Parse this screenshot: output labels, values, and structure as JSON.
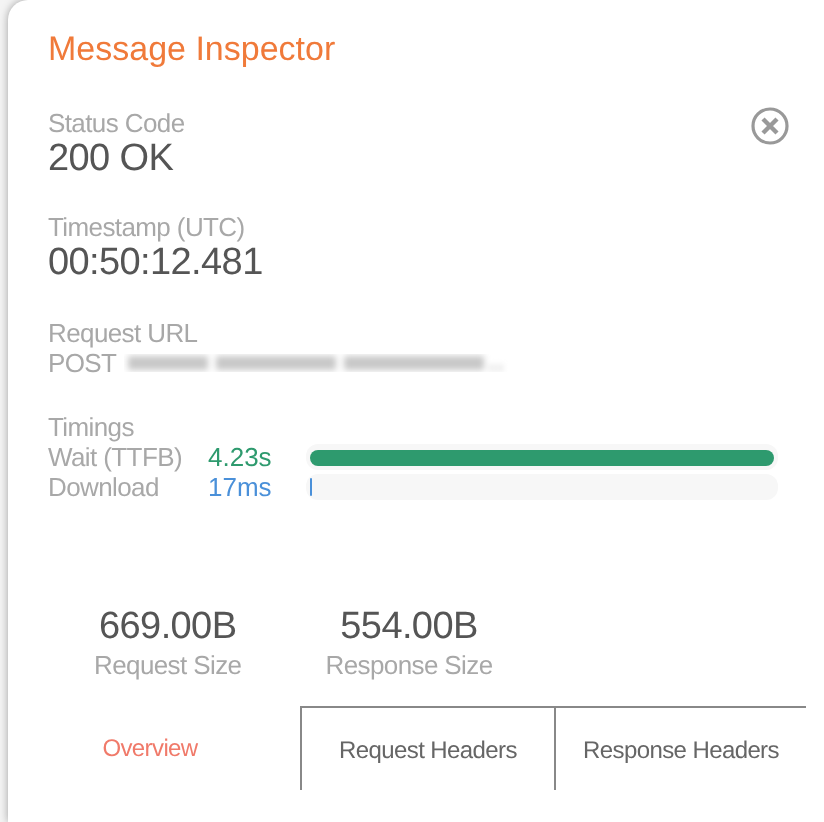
{
  "panel": {
    "title": "Message Inspector"
  },
  "status": {
    "label": "Status Code",
    "value": "200 OK"
  },
  "timestamp": {
    "label": "Timestamp (UTC)",
    "value": "00:50:12.481"
  },
  "request_url": {
    "label": "Request URL",
    "method": "POST"
  },
  "timings": {
    "label": "Timings",
    "rows": [
      {
        "name": "Wait (TTFB)",
        "reading": "4.23s",
        "level": 1,
        "color": "#2e9a6e"
      },
      {
        "name": "Download",
        "reading": "17ms",
        "level": 0.004,
        "color": "#4a90d9"
      }
    ]
  },
  "sizes": [
    {
      "value": "669.00B",
      "label": "Request Size"
    },
    {
      "value": "554.00B",
      "label": "Response Size"
    }
  ],
  "tabs": [
    {
      "label": "Overview",
      "selected": true
    },
    {
      "label": "Request Headers",
      "selected": false
    },
    {
      "label": "Response Headers",
      "selected": false
    }
  ]
}
